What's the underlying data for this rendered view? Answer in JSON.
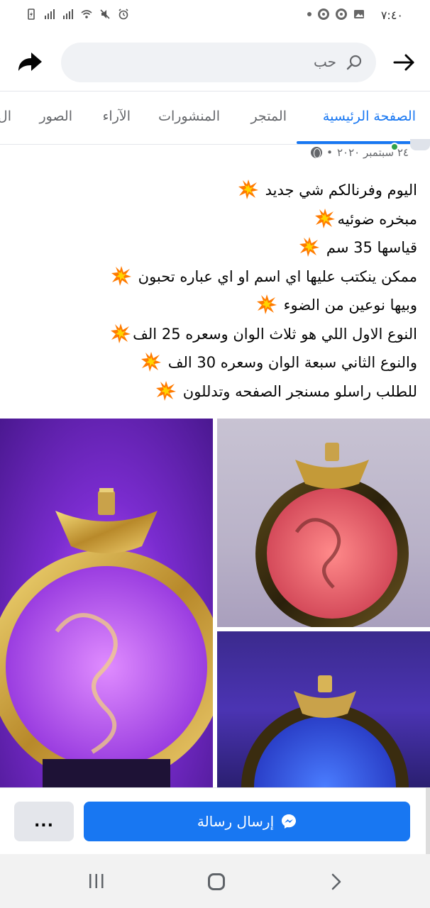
{
  "status_bar": {
    "time": "٧:٤٠",
    "icons": [
      "notification-dot",
      "chrome-icon",
      "chrome-icon",
      "image-icon",
      "alarm-icon",
      "mute-icon",
      "wifi-icon",
      "signal-icon",
      "signal-icon",
      "battery-icon"
    ]
  },
  "header": {
    "search_text": "حب",
    "search_icon": "search-icon",
    "back_icon": "arrow-right-icon",
    "share_icon": "share-icon"
  },
  "tabs": [
    {
      "label": "الصفحة الرئيسية",
      "active": true
    },
    {
      "label": "المتجر",
      "active": false
    },
    {
      "label": "المنشورات",
      "active": false
    },
    {
      "label": "الآراء",
      "active": false
    },
    {
      "label": "الصور",
      "active": false
    },
    {
      "label": "ال",
      "active": false
    }
  ],
  "post": {
    "date": "٢٤ سبتمبر ٢٠٢٠",
    "separator": "•",
    "lines": [
      "اليوم وفرنالكم شي جديد",
      "مبخره ضوئيه",
      "قياسها 35 سم",
      "ممكن ينكتب عليها اي اسم او اي عباره تحبون",
      "وبيها نوعين من الضوء",
      "النوع الاول اللي هو ثلاث الوان وسعره 25 الف",
      "والنوع الثاني سبعة الوان وسعره 30 الف",
      "للطلب راسلو مسنجر الصفحه وتدللون"
    ],
    "images": [
      {
        "glow": "#c45bff",
        "name": "photo-purple-light"
      },
      {
        "glow": "#ff5a6e",
        "name": "photo-red-light"
      },
      {
        "glow": "#3b6dff",
        "name": "photo-blue-light"
      }
    ]
  },
  "actions": {
    "more_label": "...",
    "send_label": "إرسال رسالة",
    "send_icon": "messenger-icon"
  },
  "colors": {
    "accent": "#1877f2",
    "text": "#050505",
    "muted": "#65676b",
    "burst": "#ff7a00"
  }
}
